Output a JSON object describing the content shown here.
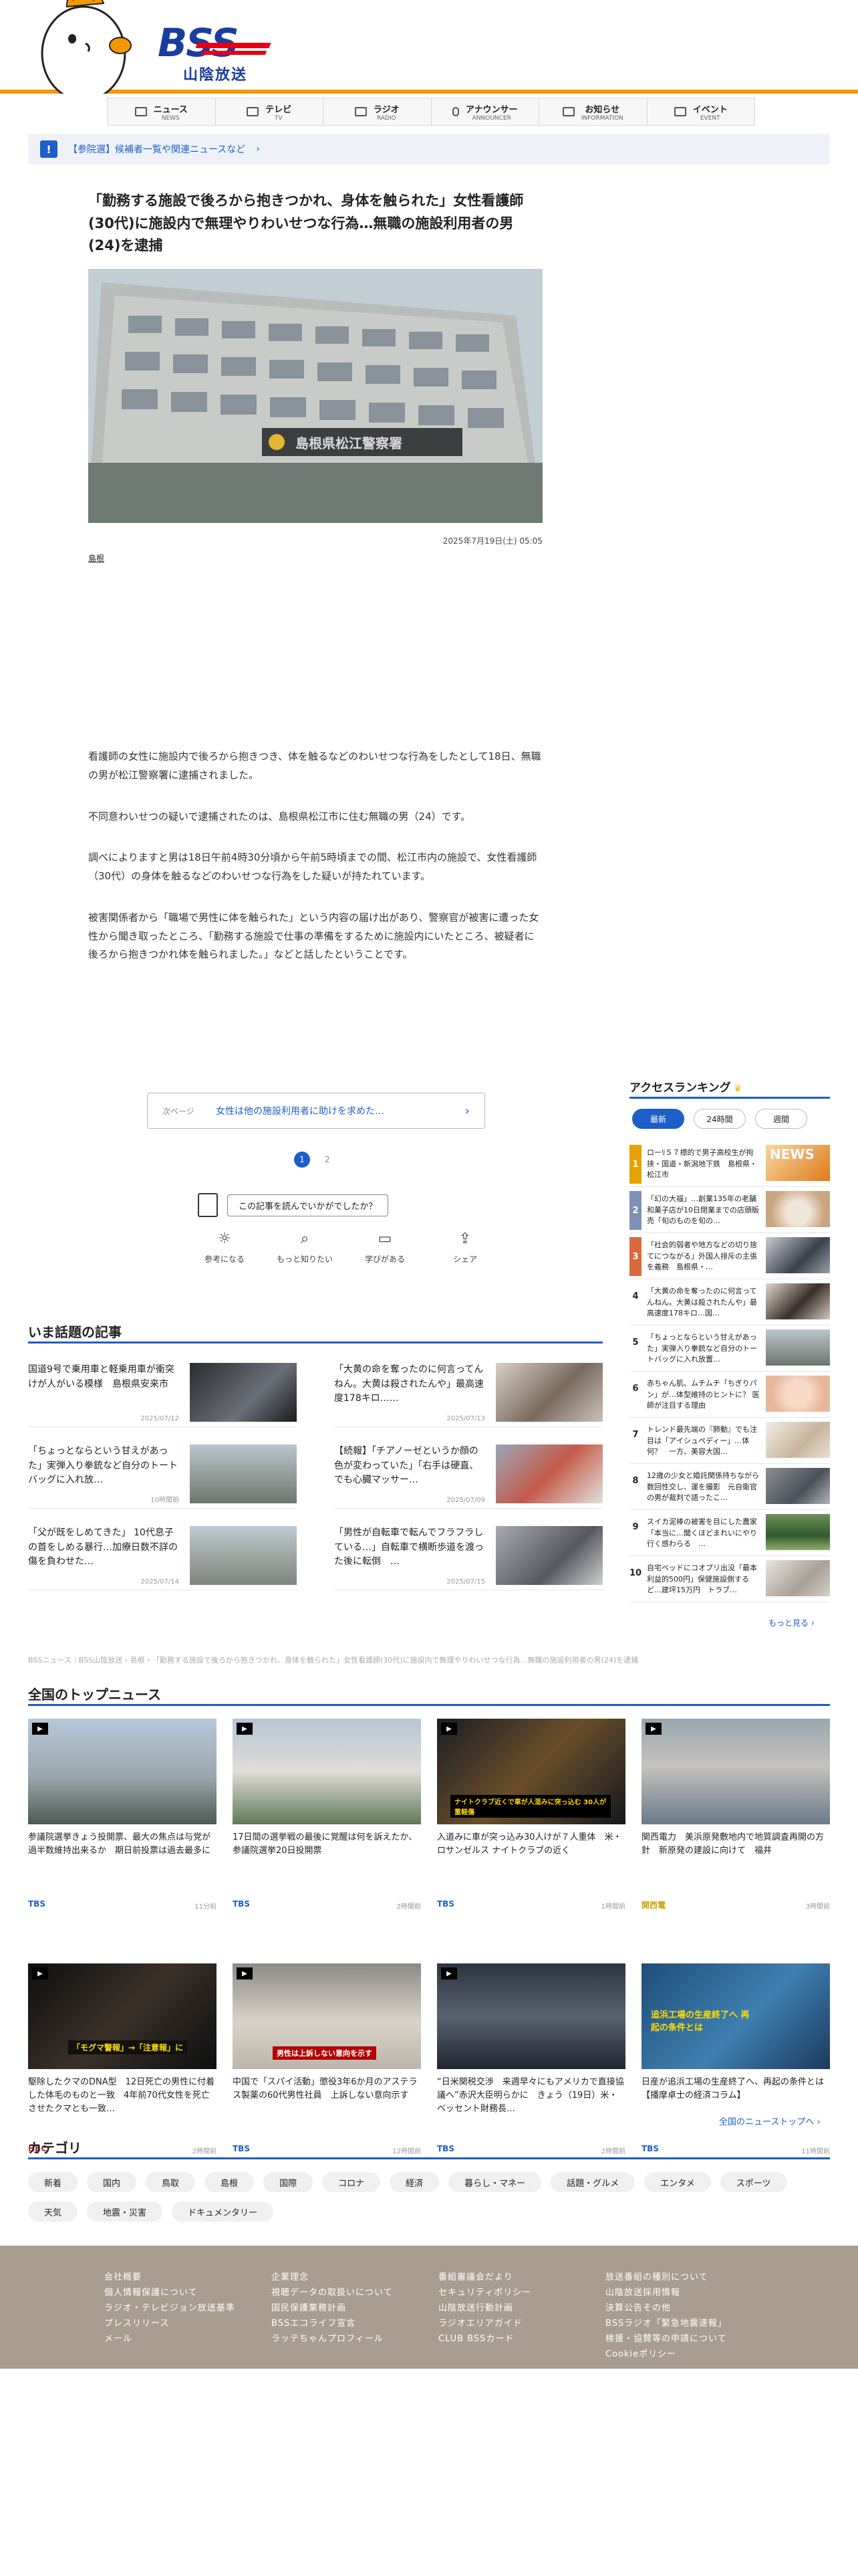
{
  "nav": [
    {
      "ja": "ニュース",
      "en": "NEWS",
      "icon": "news-icon"
    },
    {
      "ja": "テレビ",
      "en": "TV",
      "icon": "tv-icon"
    },
    {
      "ja": "ラジオ",
      "en": "RADIO",
      "icon": "radio-icon"
    },
    {
      "ja": "アナウンサー",
      "en": "ANNOUNCER",
      "icon": "microphone-icon"
    },
    {
      "ja": "お知らせ",
      "en": "INFORMATION",
      "icon": "megaphone-icon"
    },
    {
      "ja": "イベント",
      "en": "EVENT",
      "icon": "event-icon"
    }
  ],
  "logo": {
    "mark": "BSS",
    "name": "山陰放送"
  },
  "notice": {
    "text": "【参院選】候補者一覧や関連ニュースなど",
    "chevron": "›"
  },
  "article": {
    "headline": "「勤務する施設で後ろから抱きつかれ、身体を触られた」女性看護師(30代)に施設内で無理やりわいせつな行為…無職の施設利用者の男(24)を逮捕",
    "photo_sign": "島根県松江警察署",
    "date": "2025年7月19日(土) 05:05",
    "tag": "島根",
    "paragraphs": [
      "看護師の女性に施設内で後ろから抱きつき、体を触るなどのわいせつな行為をしたとして18日、無職の男が松江警察署に逮捕されました。",
      "不同意わいせつの疑いで逮捕されたのは、島根県松江市に住む無職の男（24）です。",
      "調べによりますと男は18日午前4時30分頃から午前5時頃までの間、松江市内の施設で、女性看護師（30代）の身体を触るなどのわいせつな行為をした疑いが持たれています。",
      "被害関係者から「職場で男性に体を触られた」という内容の届け出があり、警察官が被害に遭った女性から聞き取ったところ、「勤務する施設で仕事の準備をするために施設内にいたところ、被疑者に後ろから抱きつかれ体を触られました。」などと話したということです。"
    ],
    "next_label": "次ページ",
    "next_text": "女性は他の施設利用者に助けを求めた…",
    "pages": [
      "1",
      "2"
    ],
    "rating_question": "この記事を読んでいかがでしたか？",
    "reactions": [
      {
        "label": "参考になる",
        "icon": "lightbulb-icon",
        "glyph": "☼"
      },
      {
        "label": "もっと知りたい",
        "icon": "magnifier-icon",
        "glyph": "⌕"
      },
      {
        "label": "学びがある",
        "icon": "book-icon",
        "glyph": "▭"
      },
      {
        "label": "シェア",
        "icon": "share-icon",
        "glyph": "⇪"
      }
    ]
  },
  "trending": {
    "title": "いま話題の記事",
    "items": [
      {
        "title": "国道9号で乗用車と軽乗用車が衝突　けが人がいる模様　島根県安来市",
        "date": "2025/07/12"
      },
      {
        "title": "「大黄の命を奪ったのに何言ってんねん。大黄は殺されたんや」最高速度178キロ……",
        "date": "2025/07/13"
      },
      {
        "title": "「ちょっとならという甘えがあった」実弾入り拳銃など自分のトートバッグに入れ放…",
        "date": "10時間前"
      },
      {
        "title": "【続報】「チアノーゼというか顔の色が変わっていた」「右手は硬直、でも心臓マッサー…",
        "date": "2025/07/09"
      },
      {
        "title": "「父が既をしめてきた」 10代息子の首をしめる暴行…加療日数不詳の傷を負わせた…",
        "date": "2025/07/14"
      },
      {
        "title": "「男性が自転車で転んでフラフラしている…」自転車で横断歩道を渡った後に転倒　…",
        "date": "2025/07/15"
      }
    ]
  },
  "breadcrumb": "BSSニュース｜BSS山陰放送 › 島根 › 「勤務する施設で後ろから抱きつかれ、身体を触られた」女性看護師(30代)に施設内で無理やりわいせつな行為…無職の施設利用者の男(24)を逮捕",
  "ranking": {
    "title": "アクセスランキング",
    "tabs": [
      "最新",
      "24時間",
      "週間"
    ],
    "items": [
      {
        "n": "1",
        "title": "ローﾘ５７標的で男子高校生が拘挟・国道・新潟地下鉄　島根県・松江市",
        "color": "#e6a100"
      },
      {
        "n": "2",
        "title": "「幻の大福」…創業135年の老舗和菓子店が10日閉業までの店頭販売「旬のものを旬の…",
        "color": "#7f90b5"
      },
      {
        "n": "3",
        "title": "「社会的弱者や地方などの切り捨てにつながる」外国人排斥の主張を義務　島根県・…",
        "color": "#d9683a"
      },
      {
        "n": "4",
        "title": "「大黄の命を奪ったのに何言ってんねん。大黄は殺されたんや」最高速度178キロ…国…",
        "color": ""
      },
      {
        "n": "5",
        "title": "「ちょっとならという甘えがあった」実弾入り拳銃など自分のトートバッグに入れ放置…",
        "color": ""
      },
      {
        "n": "6",
        "title": "赤ちゃん肌、ムチムチ「ちぎりパン」が…体型維持のヒントに？ 医師が注目する理由",
        "color": ""
      },
      {
        "n": "7",
        "title": "トレンド最先端の『肺動』でも注目は「アイシュペディー」…体何？　一方、美容大国…",
        "color": ""
      },
      {
        "n": "8",
        "title": "12歳の少女と婚託関係持ちながら数回性交し、運を撮影　元自衛官の男が裁判で語ったこ…",
        "color": ""
      },
      {
        "n": "9",
        "title": "スイカ泥棒の被害を目にした農家「本当に…聞くほどまれいにやり行く感わらる　…",
        "color": ""
      },
      {
        "n": "10",
        "title": "自宅ベッドにコオプリ出没「最本利益的500円」保健施設側するど…建坪15万円　トラブ…",
        "color": ""
      }
    ],
    "more": "もっと見る ›"
  },
  "national": {
    "title": "全国のトップニュース",
    "items": [
      {
        "title": "参議院選挙きょう投開票、最大の焦点は与党が過半数維持出来るか　期日前投票は過去最多に",
        "src": "TBS",
        "src_color": "#1e5ec8",
        "date": "11分前"
      },
      {
        "title": "17日間の選挙戦の最後に覚醒は何を訴えたか、参議院選挙20日投開票",
        "src": "TBS",
        "src_color": "#1e5ec8",
        "date": "2時間前"
      },
      {
        "title": "入道みに車が突っ込み30人けが７人重体　米・ロサンゼルス ナイトクラブの近く",
        "src": "TBS",
        "src_color": "#1e5ec8",
        "date": "1時間前"
      },
      {
        "title": "関西電力　美浜原発敷地内で地質調査再開の方針　新原発の建設に向けて　福井",
        "src": "関西電",
        "src_color": "#c8a400",
        "date": "3時間前"
      },
      {
        "title": "駆除したクマのDNA型　12日死亡の男性に付着した体毛のものと一致　4年前70代女性を死亡させたクマとも一致…",
        "src": "HBC",
        "src_color": "#cc1f2d",
        "date": "2時間前"
      },
      {
        "title": "中国で「スパイ活動」懲役3年6か月のアステラス製薬の60代男性社員　上訴しない意向示す",
        "src": "TBS",
        "src_color": "#1e5ec8",
        "date": "12時間前"
      },
      {
        "title": "“日米関税交渉　来週早々にもアメリカで直接協議へ”赤沢大臣明らかに　きょう（19日）米・ベッセント財務長…",
        "src": "TBS",
        "src_color": "#1e5ec8",
        "date": "2時間前"
      },
      {
        "title": "日産が追浜工場の生産終了へ、再起の条件とは【播摩卓士の経済コラム】",
        "src": "TBS",
        "src_color": "#1e5ec8",
        "date": "11時間前"
      }
    ],
    "thumb_captions": [
      "",
      "",
      "ナイトクラブ近くで車が人混みに突っ込む 30人が重軽傷",
      "",
      "「モグマ警報」→「注意報」に",
      "男性は上訴しない意向を示す",
      "",
      "追浜工場の生産終了へ 再起の条件とは"
    ],
    "more": "全国のニューストップへ ›"
  },
  "categories": {
    "title": "カテゴリ",
    "items": [
      "新着",
      "国内",
      "鳥取",
      "島根",
      "国際",
      "コロナ",
      "経済",
      "暮らし・マネー",
      "話題・グルメ",
      "エンタメ",
      "スポーツ",
      "天気",
      "地震・災害",
      "ドキュメンタリー"
    ]
  },
  "footer": {
    "col1": [
      "会社概要",
      "個人情報保護について",
      "ラジオ・テレビジョン放送基準",
      "プレスリリース",
      "メール"
    ],
    "col2": [
      "企業理念",
      "視聴データの取扱いについて",
      "国民保護業務計画",
      "BSSエコライフ宣言",
      "ラッテちゃんプロフィール"
    ],
    "col3": [
      "番組審議会だより",
      "セキュリティポリシー",
      "山陰放送行動計画",
      "ラジオエリアガイド",
      "CLUB BSSカード"
    ],
    "col4": [
      "放送番組の種別について",
      "山陰放送採用情報",
      "決算公告その他",
      "BSSラジオ「緊急地震速報」",
      "検援・協賛等の申請について",
      "Cookieポリシー"
    ]
  },
  "colors": {
    "accent": "#1e5ec8",
    "header_bar": "#f39800",
    "brand": "#1a3d9e",
    "footer": "#a89d8f"
  }
}
